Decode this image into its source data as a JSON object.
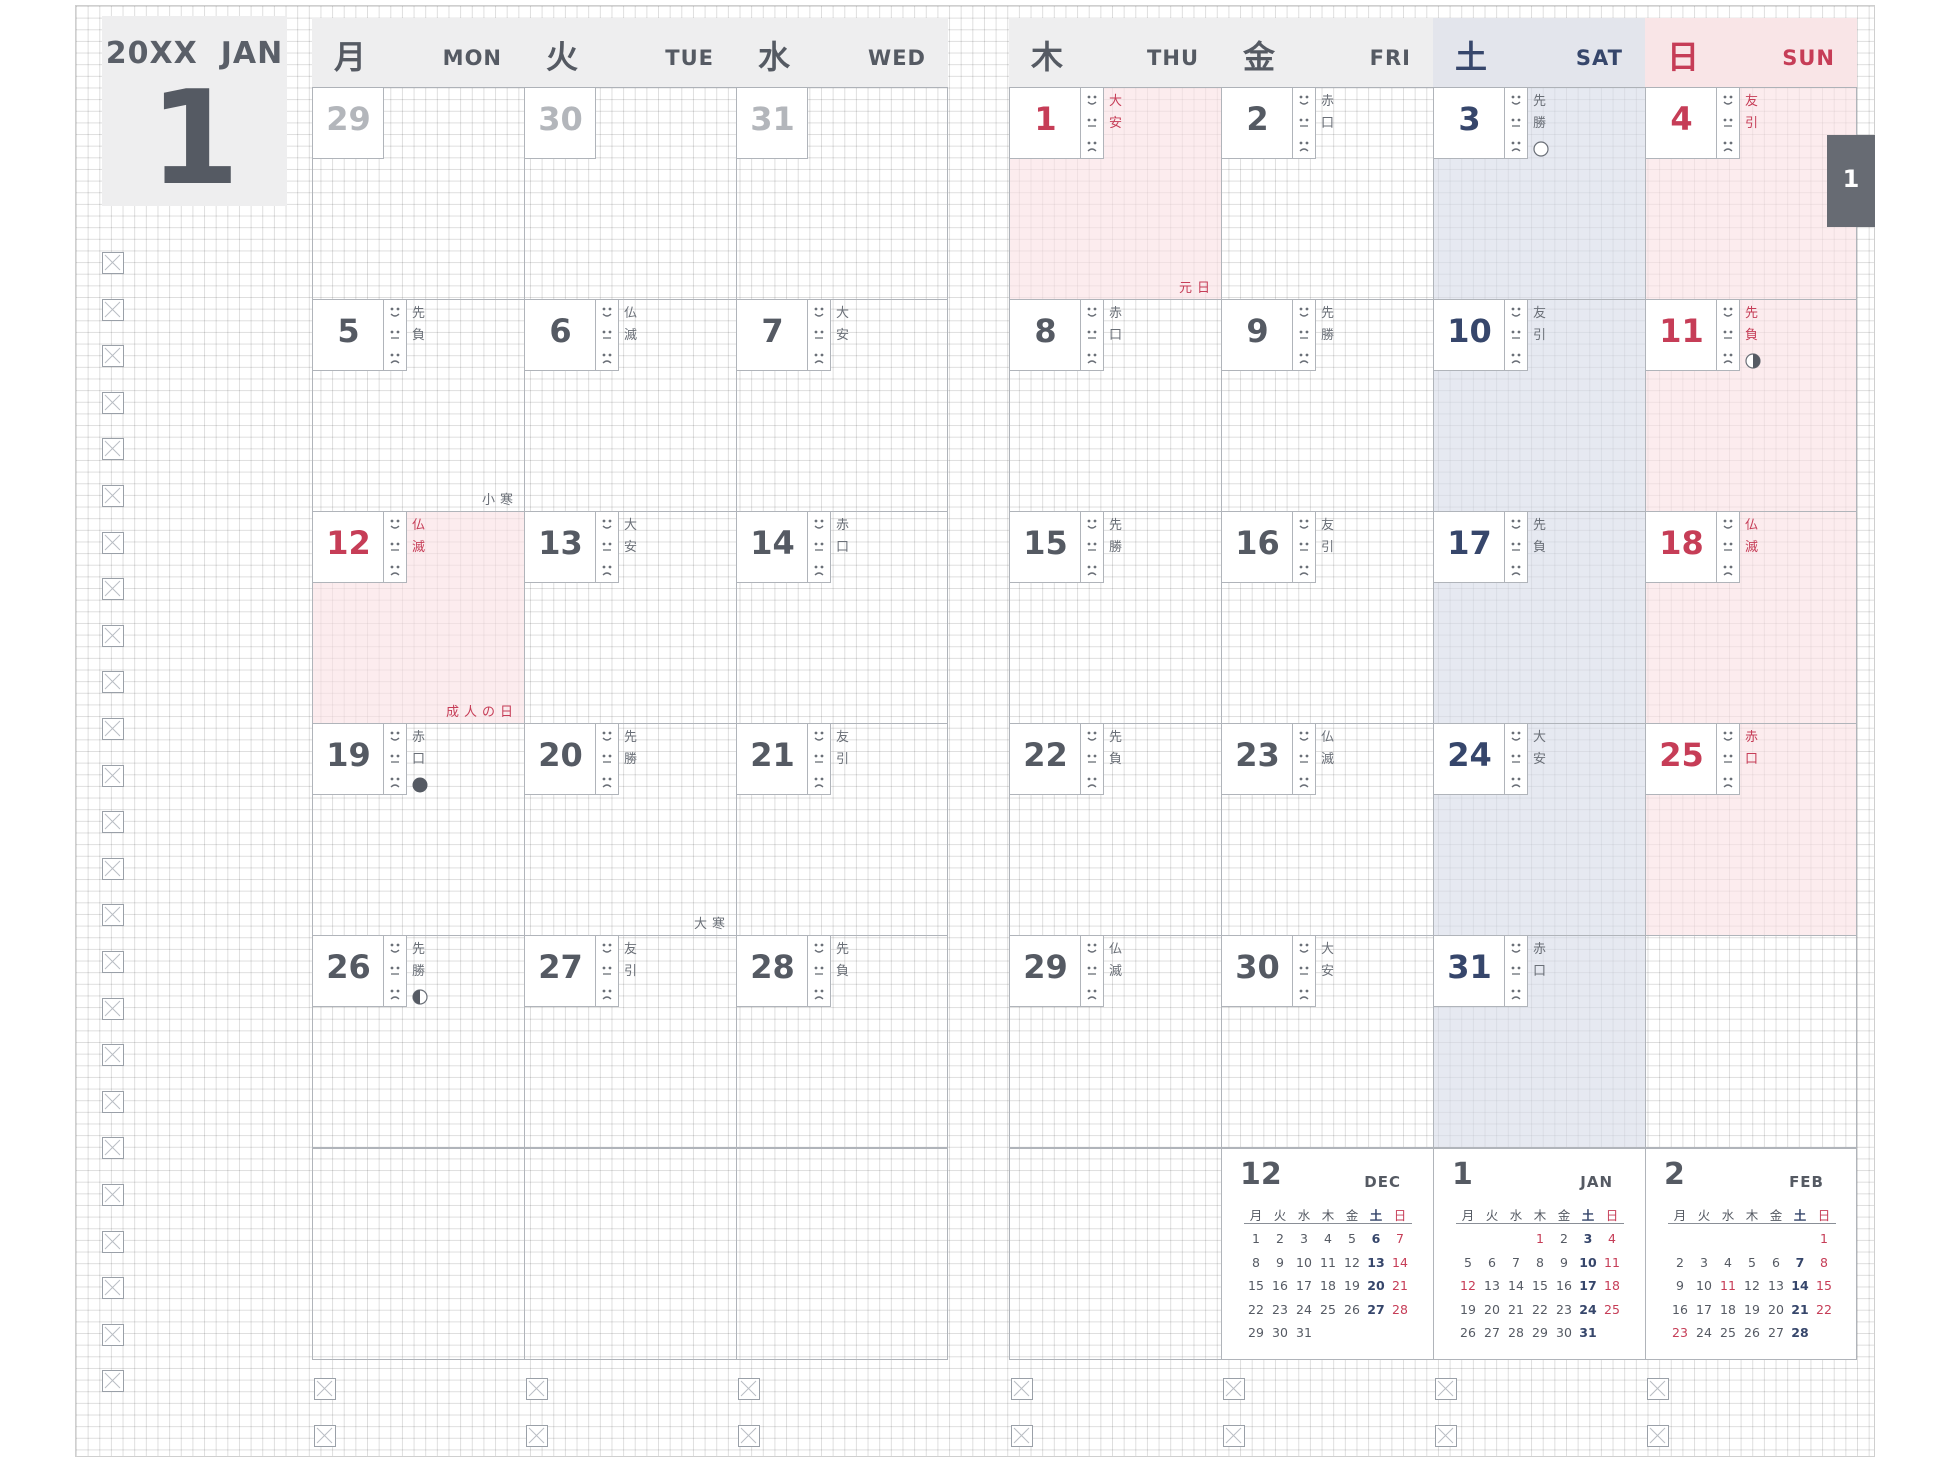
{
  "month": {
    "year": "20XX",
    "name": "JAN",
    "number": "1"
  },
  "tab_label": "1",
  "colors": {
    "accent_red": "#c63d57",
    "accent_navy": "#36466b",
    "text": "#555a63",
    "grid_line": "#b0b4ba"
  },
  "weekdays": [
    {
      "jp": "月",
      "en": "MON",
      "kind": "normal"
    },
    {
      "jp": "火",
      "en": "TUE",
      "kind": "normal"
    },
    {
      "jp": "水",
      "en": "WED",
      "kind": "normal"
    },
    {
      "jp": "木",
      "en": "THU",
      "kind": "normal"
    },
    {
      "jp": "金",
      "en": "FRI",
      "kind": "normal"
    },
    {
      "jp": "土",
      "en": "SAT",
      "kind": "sat"
    },
    {
      "jp": "日",
      "en": "SUN",
      "kind": "sun"
    }
  ],
  "weeks": [
    [
      {
        "day": "29",
        "style": "grey"
      },
      {
        "day": "30",
        "style": "grey"
      },
      {
        "day": "31",
        "style": "grey"
      },
      {
        "day": "1",
        "style": "red",
        "rokuyo": "大安",
        "rokuyo_red": true,
        "pink": true,
        "note": "元日"
      },
      {
        "day": "2",
        "style": "normal",
        "rokuyo": "赤口"
      },
      {
        "day": "3",
        "style": "navy",
        "rokuyo": "先勝",
        "moon": "full"
      },
      {
        "day": "4",
        "style": "red",
        "rokuyo": "友引",
        "rokuyo_red": true
      }
    ],
    [
      {
        "day": "5",
        "style": "normal",
        "rokuyo": "先負",
        "note": "小寒"
      },
      {
        "day": "6",
        "style": "normal",
        "rokuyo": "仏滅"
      },
      {
        "day": "7",
        "style": "normal",
        "rokuyo": "大安"
      },
      {
        "day": "8",
        "style": "normal",
        "rokuyo": "赤口"
      },
      {
        "day": "9",
        "style": "normal",
        "rokuyo": "先勝"
      },
      {
        "day": "10",
        "style": "navy",
        "rokuyo": "友引"
      },
      {
        "day": "11",
        "style": "red",
        "rokuyo": "先負",
        "rokuyo_red": true,
        "moon": "last"
      }
    ],
    [
      {
        "day": "12",
        "style": "red",
        "rokuyo": "仏滅",
        "rokuyo_red": true,
        "pink": true,
        "note": "成人の日"
      },
      {
        "day": "13",
        "style": "normal",
        "rokuyo": "大安"
      },
      {
        "day": "14",
        "style": "normal",
        "rokuyo": "赤口"
      },
      {
        "day": "15",
        "style": "normal",
        "rokuyo": "先勝"
      },
      {
        "day": "16",
        "style": "normal",
        "rokuyo": "友引"
      },
      {
        "day": "17",
        "style": "navy",
        "rokuyo": "先負"
      },
      {
        "day": "18",
        "style": "red",
        "rokuyo": "仏滅",
        "rokuyo_red": true
      }
    ],
    [
      {
        "day": "19",
        "style": "normal",
        "rokuyo": "赤口",
        "moon": "new"
      },
      {
        "day": "20",
        "style": "normal",
        "rokuyo": "先勝",
        "note": "大寒"
      },
      {
        "day": "21",
        "style": "normal",
        "rokuyo": "友引"
      },
      {
        "day": "22",
        "style": "normal",
        "rokuyo": "先負"
      },
      {
        "day": "23",
        "style": "normal",
        "rokuyo": "仏滅"
      },
      {
        "day": "24",
        "style": "navy",
        "rokuyo": "大安"
      },
      {
        "day": "25",
        "style": "red",
        "rokuyo": "赤口",
        "rokuyo_red": true
      }
    ],
    [
      {
        "day": "26",
        "style": "normal",
        "rokuyo": "先勝",
        "moon": "first"
      },
      {
        "day": "27",
        "style": "normal",
        "rokuyo": "友引"
      },
      {
        "day": "28",
        "style": "normal",
        "rokuyo": "先負"
      },
      {
        "day": "29",
        "style": "normal",
        "rokuyo": "仏滅"
      },
      {
        "day": "30",
        "style": "normal",
        "rokuyo": "大安"
      },
      {
        "day": "31",
        "style": "navy",
        "rokuyo": "赤口"
      },
      {
        "day": "",
        "style": "empty"
      }
    ]
  ],
  "mini_calendars": [
    {
      "num": "12",
      "en": "DEC",
      "header": [
        "月",
        "火",
        "水",
        "木",
        "金",
        "土",
        "日"
      ],
      "weeks": [
        [
          "1",
          "2",
          "3",
          "4",
          "5",
          "6",
          "7"
        ],
        [
          "8",
          "9",
          "10",
          "11",
          "12",
          "13",
          "14"
        ],
        [
          "15",
          "16",
          "17",
          "18",
          "19",
          "20",
          "21"
        ],
        [
          "22",
          "23",
          "24",
          "25",
          "26",
          "27",
          "28"
        ],
        [
          "29",
          "30",
          "31",
          "",
          "",
          "",
          ""
        ]
      ],
      "holidays": []
    },
    {
      "num": "1",
      "en": "JAN",
      "header": [
        "月",
        "火",
        "水",
        "木",
        "金",
        "土",
        "日"
      ],
      "weeks": [
        [
          "",
          "",
          "",
          "1",
          "2",
          "3",
          "4"
        ],
        [
          "5",
          "6",
          "7",
          "8",
          "9",
          "10",
          "11"
        ],
        [
          "12",
          "13",
          "14",
          "15",
          "16",
          "17",
          "18"
        ],
        [
          "19",
          "20",
          "21",
          "22",
          "23",
          "24",
          "25"
        ],
        [
          "26",
          "27",
          "28",
          "29",
          "30",
          "31",
          ""
        ]
      ],
      "holidays": [
        "1",
        "12"
      ]
    },
    {
      "num": "2",
      "en": "FEB",
      "header": [
        "月",
        "火",
        "水",
        "木",
        "金",
        "土",
        "日"
      ],
      "weeks": [
        [
          "",
          "",
          "",
          "",
          "",
          "",
          "1"
        ],
        [
          "2",
          "3",
          "4",
          "5",
          "6",
          "7",
          "8"
        ],
        [
          "9",
          "10",
          "11",
          "12",
          "13",
          "14",
          "15"
        ],
        [
          "16",
          "17",
          "18",
          "19",
          "20",
          "21",
          "22"
        ],
        [
          "23",
          "24",
          "25",
          "26",
          "27",
          "28",
          ""
        ]
      ],
      "holidays": [
        "11",
        "23"
      ]
    }
  ]
}
